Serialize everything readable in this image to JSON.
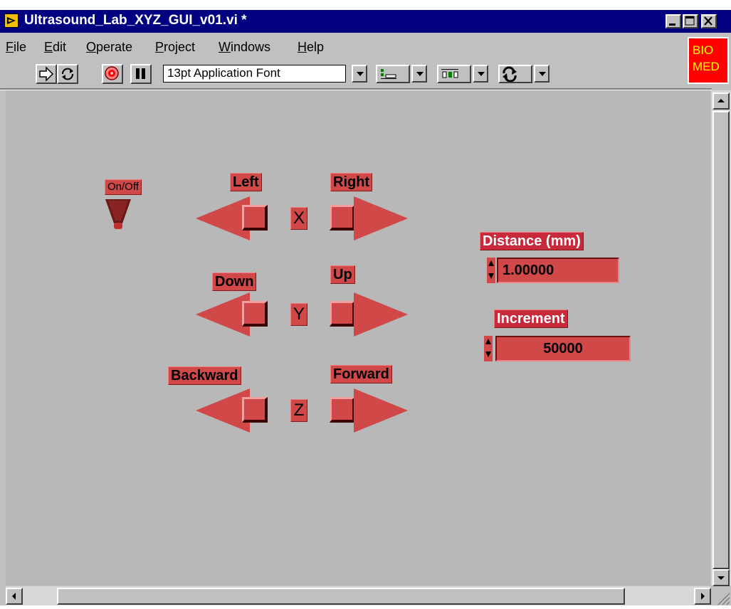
{
  "window": {
    "title": "Ultrasound_Lab_XYZ_GUI_v01.vi *"
  },
  "menu": {
    "items": [
      {
        "underline": "F",
        "rest": "ile"
      },
      {
        "underline": "E",
        "rest": "dit"
      },
      {
        "underline": "O",
        "rest": "perate"
      },
      {
        "underline": "P",
        "rest": "roject"
      },
      {
        "underline": "W",
        "rest": "indows"
      },
      {
        "underline": "H",
        "rest": "elp"
      }
    ]
  },
  "logo": {
    "line1": "BIO",
    "line2": "MED"
  },
  "toolbar": {
    "font_setting": "13pt Application Font"
  },
  "panel": {
    "power_label": "On/Off",
    "x": {
      "axis": "X",
      "neg_label": "Left",
      "pos_label": "Right"
    },
    "y": {
      "axis": "Y",
      "neg_label": "Down",
      "pos_label": "Up"
    },
    "z": {
      "axis": "Z",
      "neg_label": "Backward",
      "pos_label": "Forward"
    },
    "distance": {
      "label": "Distance (mm)",
      "value": "1.00000"
    },
    "increment": {
      "label": "Increment",
      "value": "50000"
    }
  },
  "colors": {
    "titlebar": "#000080",
    "panel": "#b8b8b8",
    "control_red": "#d04848",
    "logo": "#ff0000"
  }
}
